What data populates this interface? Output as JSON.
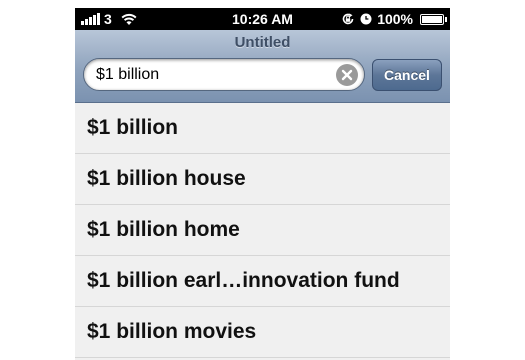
{
  "status_bar": {
    "carrier": "3",
    "time": "10:26 AM",
    "battery": "100%",
    "battery_level": 1.0,
    "signal_bars": 5,
    "icons": [
      "signal-icon",
      "wifi-icon",
      "rotation-lock-icon",
      "alarm-icon",
      "battery-icon"
    ]
  },
  "nav": {
    "title": "Untitled",
    "search": {
      "value": "$1 billion",
      "clear_icon": "clear-icon"
    },
    "cancel_label": "Cancel"
  },
  "suggestions": [
    "$1 billion",
    "$1 billion house",
    "$1 billion home",
    "$1 billion earl…innovation fund",
    "$1 billion movies"
  ],
  "colors": {
    "nav_bar": "#8fa3bd",
    "cancel_button": "#5d7698",
    "list_background": "#f0f0f0"
  }
}
